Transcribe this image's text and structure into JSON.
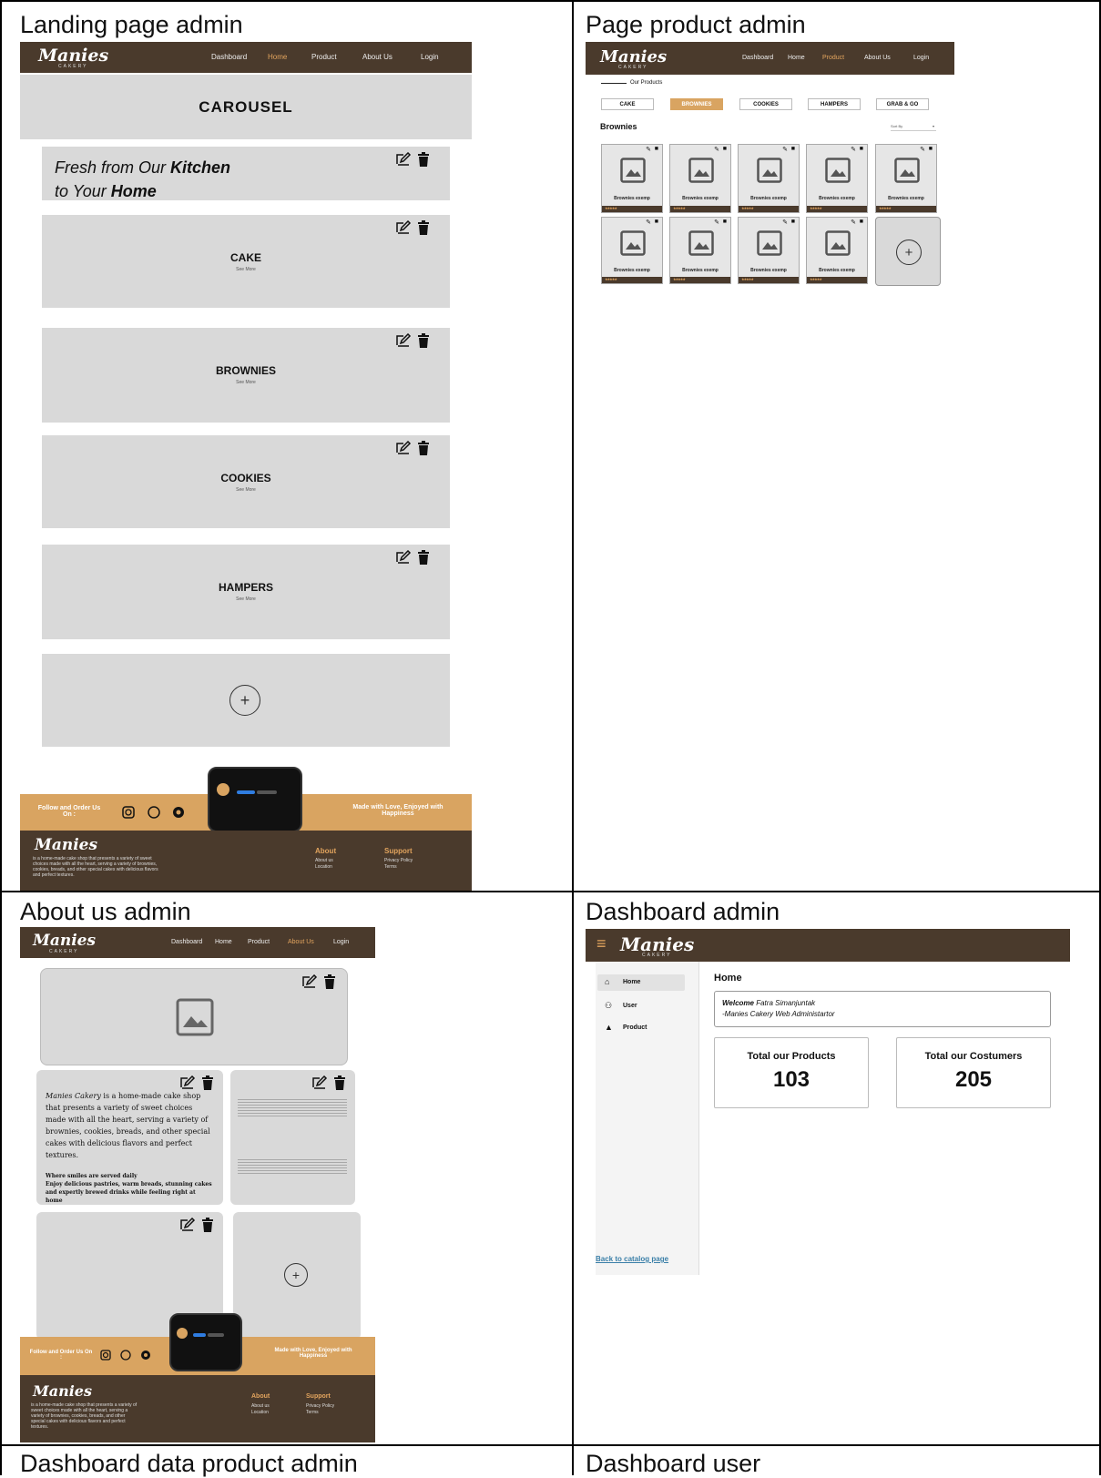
{
  "table": {
    "cells": {
      "landing_title": "Landing page admin",
      "product_title": "Page product admin",
      "about_title": "About us admin",
      "dashboard_title": "Dashboard admin",
      "data_product_title": "Dashboard data product admin",
      "user_title": "Dashboard user"
    }
  },
  "brand": {
    "logo": "Manies",
    "sub": "CAKERY"
  },
  "nav": {
    "dashboard": "Dashboard",
    "home": "Home",
    "product": "Product",
    "about": "About Us",
    "login": "Login"
  },
  "landing": {
    "carousel": "CAROUSEL",
    "hero_line1a": "Fresh from Our ",
    "hero_line1b": "Kitchen",
    "hero_line2a": "to Your ",
    "hero_line2b": "Home",
    "categories": [
      {
        "name": "CAKE",
        "link": "See More"
      },
      {
        "name": "BROWNIES",
        "link": "See More"
      },
      {
        "name": "COOKIES",
        "link": "See More"
      },
      {
        "name": "HAMPERS",
        "link": "See More"
      }
    ],
    "add_symbol": "+"
  },
  "footer": {
    "follow": "Follow and Order Us On :",
    "tagline": "Made with Love, Enjoyed with Happiness",
    "about_head": "About",
    "about_items": [
      "About us",
      "Location"
    ],
    "support_head": "Support",
    "support_items": [
      "Privacy Policy",
      "Terms"
    ]
  },
  "product_page": {
    "section_label": "Our Products",
    "tabs": [
      "CAKE",
      "BROWNIES",
      "COOKIES",
      "HAMPERS",
      "GRAB & GO"
    ],
    "active_tab": "BROWNIES",
    "heading": "Brownies",
    "sort": "Sort By",
    "card_label": "Brownies exemp",
    "add_symbol": "+"
  },
  "about_page": {
    "brand_inline": "Manies Cakery",
    "para": "is a home-made cake shop that presents a variety of sweet choices made with all the heart, serving a variety of brownies, cookies, breads, and other special cakes with delicious flavors and perfect textures.",
    "sub1": "Where smiles are served daily",
    "sub2": "Enjoy delicious pastries, warm breads, stunning cakes and expertly brewed drinks while feeling right at home",
    "add_symbol": "+"
  },
  "dashboard": {
    "menu": [
      "Home",
      "User",
      "Product"
    ],
    "heading": "Home",
    "welcome_label": "Welcome",
    "welcome_name": "Fatra Simanjuntak",
    "welcome_role": "-Manies Cakery Web Administartor",
    "products_label": "Total our Products",
    "products_value": "103",
    "customers_label": "Total our Costumers",
    "customers_value": "205",
    "back_link": "Back to catalog page"
  },
  "colors": {
    "brown": "#4a3a2c",
    "gold": "#d9a461",
    "accent": "#e2a45e",
    "grey": "#d9d9d9"
  }
}
